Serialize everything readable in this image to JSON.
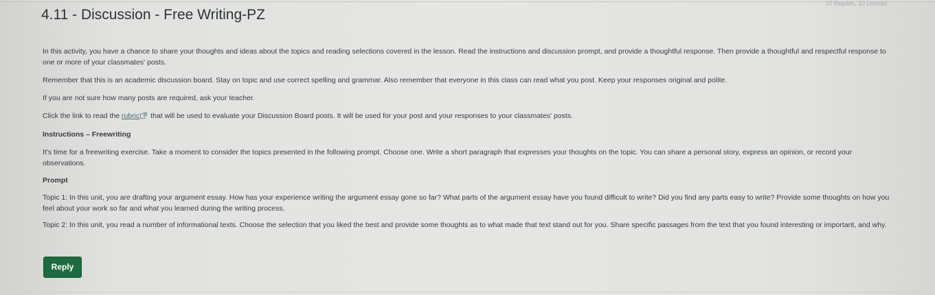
{
  "header": {
    "title": "4.11 - Discussion - Free Writing-PZ",
    "reply_count": "10 Replies, 10 Unread"
  },
  "body": {
    "intro": "In this activity, you have a chance to share your thoughts and ideas about the topics and reading selections covered in the lesson. Read the instructions and discussion prompt, and provide a thoughtful response. Then provide a thoughtful and respectful response to one or more of your classmates' posts.",
    "remember": "Remember that this is an academic discussion board. Stay on topic and use correct spelling and grammar. Also remember that everyone in this class can read what you post. Keep your responses original and polite.",
    "not_sure": "If you are not sure how many posts are required, ask your teacher.",
    "rubric_before": "Click the link to read the ",
    "rubric_link": "rubric",
    "rubric_after": " that will be used to evaluate your Discussion Board posts. It will be used for your post and your responses to your classmates' posts.",
    "instructions_heading": "Instructions – Freewriting",
    "freewriting": "It's time for a freewriting exercise. Take a moment to consider the topics presented in the following prompt. Choose one. Write a short paragraph that expresses your thoughts on the topic. You can share a personal story, express an opinion, or record your observations.",
    "prompt_heading": "Prompt",
    "topic1": "Topic 1: In this unit, you are drafting your argument essay. How has your experience writing the argument essay gone so far? What parts of the argument essay have you found difficult to write? Did you find any parts easy to write? Provide some thoughts on how you feel about your work so far and what you learned during the writing process.",
    "topic2": "Topic 2: In this unit, you read a number of informational texts. Choose the selection that you liked the best and provide some thoughts as to what made that text stand out for you. Share specific passages from the text that you found interesting or important, and why."
  },
  "actions": {
    "reply_label": "Reply"
  },
  "icons": {
    "rubric_link_icon": "external-link-icon"
  },
  "colors": {
    "reply_button": "#1d6b3f",
    "link": "#4a6a7a"
  }
}
